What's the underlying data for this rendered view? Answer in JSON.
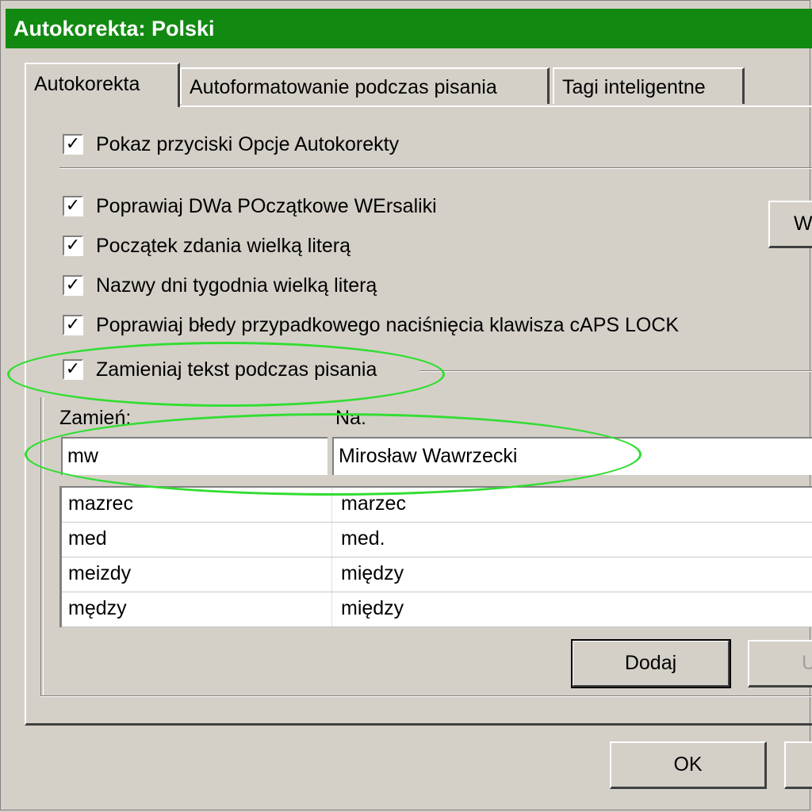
{
  "window": {
    "title": "Autokorekta: Polski"
  },
  "tabs": [
    {
      "label": "Autokorekta"
    },
    {
      "label": "Autoformatowanie podczas pisania"
    },
    {
      "label": "Tagi inteligentne"
    }
  ],
  "options": [
    {
      "label": "Pokaz przyciski Opcje Autokorekty",
      "checked": true
    },
    {
      "label": "Poprawiaj DWa POczątkowe WErsaliki",
      "checked": true
    },
    {
      "label": "Początek zdania wielką literą",
      "checked": true
    },
    {
      "label": "Nazwy dni tygodnia wielką literą",
      "checked": true
    },
    {
      "label": "Poprawiaj błedy przypadkowego naciśnięcia klawisza cAPS LOCK",
      "checked": true
    },
    {
      "label": "Zamieniaj tekst podczas pisania",
      "checked": true
    }
  ],
  "exceptions_button": {
    "label": "W"
  },
  "replace": {
    "label": "Zamień:",
    "value": "mw"
  },
  "with": {
    "label": "Na:",
    "value": "Mirosław Wawrzecki"
  },
  "entries": [
    {
      "replace": "mazrec",
      "with": "marzec"
    },
    {
      "replace": "med",
      "with": "med."
    },
    {
      "replace": "meizdy",
      "with": "między"
    },
    {
      "replace": "mędzy",
      "with": "między"
    }
  ],
  "buttons": {
    "add": "Dodaj",
    "delete": "U",
    "ok": "OK"
  },
  "check_glyph": "✓",
  "highlight_color": "#33dd33"
}
